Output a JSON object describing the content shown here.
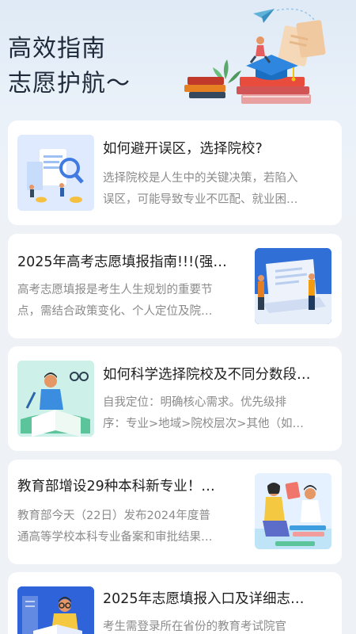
{
  "hero": {
    "title_line1": "高效指南",
    "title_line2": "志愿护航～",
    "illustration_icon": "books-graduation-cap-illustration"
  },
  "articles": [
    {
      "title": "如何避开误区，选择院校?",
      "desc_line1": "选择院校是人生中的关键决策，若陷入",
      "desc_line2": "误区，可能导致专业不匹配、就业困…",
      "thumb_icon": "document-magnifier-illustration"
    },
    {
      "title": "2025年高考志愿填报指南!!!(强…",
      "desc_line1": "高考志愿填报是考生人生规划的重要节",
      "desc_line2": "点，需结合政策变化、个人定位及院…",
      "thumb_icon": "laptop-people-illustration"
    },
    {
      "title": "如何科学选择院校及不同分数段…",
      "desc_line1": "自我定位：明确核心需求。优先级排",
      "desc_line2": "序：专业>地域>院校层次>其他（如…",
      "thumb_icon": "student-reading-book-illustration"
    },
    {
      "title": "教育部增设29种本科新专业！…",
      "desc_line1": "教育部今天（22日）发布2024年度普",
      "desc_line2": "通高等学校本科专业备案和审批结果…",
      "thumb_icon": "students-studying-illustration"
    },
    {
      "title": "2025年志愿填报入口及详细志…",
      "desc_line1": "考生需登录所在省份的教育考试院官",
      "desc_line2": "",
      "thumb_icon": "reader-with-book-illustration"
    }
  ]
}
